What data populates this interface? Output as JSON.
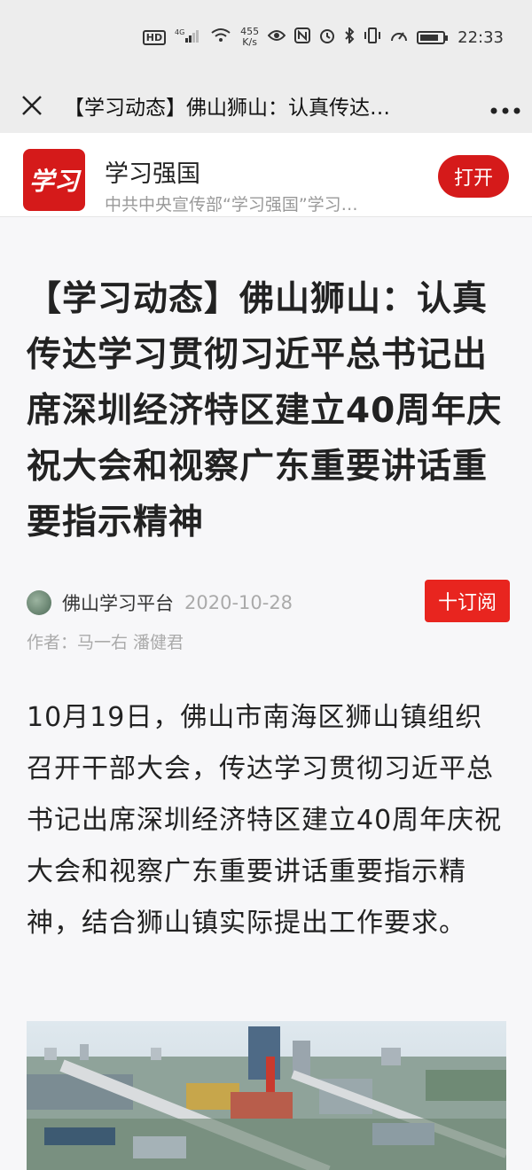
{
  "status_bar": {
    "hd": "HD",
    "network": "4G",
    "speed_value": "455",
    "speed_unit": "K/s",
    "battery_level": 0.85,
    "time": "22:33"
  },
  "nav": {
    "title": "【学习动态】佛山狮山：认真传达…"
  },
  "app_banner": {
    "logo_text": "学习",
    "name": "学习强国",
    "subtitle": "中共中央宣传部“学习强国”学习…",
    "open_label": "打开"
  },
  "article": {
    "title": "【学习动态】佛山狮山：认真传达学习贯彻习近平总书记出席深圳经济特区建立40周年庆祝大会和视察广东重要讲话重要指示精神",
    "source": "佛山学习平台",
    "date": "2020-10-28",
    "subscribe_label": "十订阅",
    "author": "作者：马一右 潘健君",
    "body": "10月19日，佛山市南海区狮山镇组织召开干部大会，传达学习贯彻习近平总书记出席深圳经济特区建立40周年庆祝大会和视察广东重要讲话重要指示精神，结合狮山镇实际提出工作要求。"
  }
}
